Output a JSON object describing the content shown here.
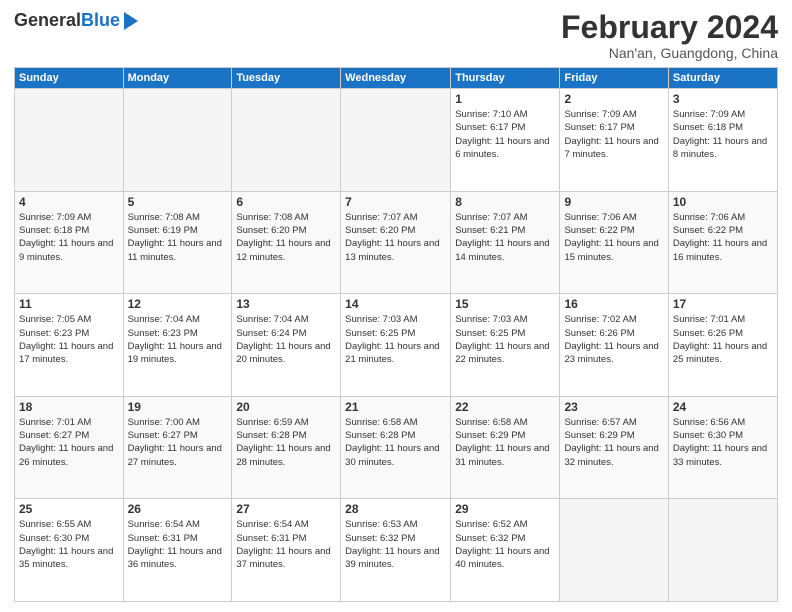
{
  "header": {
    "logo_line1": "General",
    "logo_line2": "Blue",
    "title": "February 2024",
    "location": "Nan'an, Guangdong, China"
  },
  "weekdays": [
    "Sunday",
    "Monday",
    "Tuesday",
    "Wednesday",
    "Thursday",
    "Friday",
    "Saturday"
  ],
  "weeks": [
    [
      {
        "day": "",
        "info": ""
      },
      {
        "day": "",
        "info": ""
      },
      {
        "day": "",
        "info": ""
      },
      {
        "day": "",
        "info": ""
      },
      {
        "day": "1",
        "info": "Sunrise: 7:10 AM\nSunset: 6:17 PM\nDaylight: 11 hours\nand 6 minutes."
      },
      {
        "day": "2",
        "info": "Sunrise: 7:09 AM\nSunset: 6:17 PM\nDaylight: 11 hours\nand 7 minutes."
      },
      {
        "day": "3",
        "info": "Sunrise: 7:09 AM\nSunset: 6:18 PM\nDaylight: 11 hours\nand 8 minutes."
      }
    ],
    [
      {
        "day": "4",
        "info": "Sunrise: 7:09 AM\nSunset: 6:18 PM\nDaylight: 11 hours\nand 9 minutes."
      },
      {
        "day": "5",
        "info": "Sunrise: 7:08 AM\nSunset: 6:19 PM\nDaylight: 11 hours\nand 11 minutes."
      },
      {
        "day": "6",
        "info": "Sunrise: 7:08 AM\nSunset: 6:20 PM\nDaylight: 11 hours\nand 12 minutes."
      },
      {
        "day": "7",
        "info": "Sunrise: 7:07 AM\nSunset: 6:20 PM\nDaylight: 11 hours\nand 13 minutes."
      },
      {
        "day": "8",
        "info": "Sunrise: 7:07 AM\nSunset: 6:21 PM\nDaylight: 11 hours\nand 14 minutes."
      },
      {
        "day": "9",
        "info": "Sunrise: 7:06 AM\nSunset: 6:22 PM\nDaylight: 11 hours\nand 15 minutes."
      },
      {
        "day": "10",
        "info": "Sunrise: 7:06 AM\nSunset: 6:22 PM\nDaylight: 11 hours\nand 16 minutes."
      }
    ],
    [
      {
        "day": "11",
        "info": "Sunrise: 7:05 AM\nSunset: 6:23 PM\nDaylight: 11 hours\nand 17 minutes."
      },
      {
        "day": "12",
        "info": "Sunrise: 7:04 AM\nSunset: 6:23 PM\nDaylight: 11 hours\nand 19 minutes."
      },
      {
        "day": "13",
        "info": "Sunrise: 7:04 AM\nSunset: 6:24 PM\nDaylight: 11 hours\nand 20 minutes."
      },
      {
        "day": "14",
        "info": "Sunrise: 7:03 AM\nSunset: 6:25 PM\nDaylight: 11 hours\nand 21 minutes."
      },
      {
        "day": "15",
        "info": "Sunrise: 7:03 AM\nSunset: 6:25 PM\nDaylight: 11 hours\nand 22 minutes."
      },
      {
        "day": "16",
        "info": "Sunrise: 7:02 AM\nSunset: 6:26 PM\nDaylight: 11 hours\nand 23 minutes."
      },
      {
        "day": "17",
        "info": "Sunrise: 7:01 AM\nSunset: 6:26 PM\nDaylight: 11 hours\nand 25 minutes."
      }
    ],
    [
      {
        "day": "18",
        "info": "Sunrise: 7:01 AM\nSunset: 6:27 PM\nDaylight: 11 hours\nand 26 minutes."
      },
      {
        "day": "19",
        "info": "Sunrise: 7:00 AM\nSunset: 6:27 PM\nDaylight: 11 hours\nand 27 minutes."
      },
      {
        "day": "20",
        "info": "Sunrise: 6:59 AM\nSunset: 6:28 PM\nDaylight: 11 hours\nand 28 minutes."
      },
      {
        "day": "21",
        "info": "Sunrise: 6:58 AM\nSunset: 6:28 PM\nDaylight: 11 hours\nand 30 minutes."
      },
      {
        "day": "22",
        "info": "Sunrise: 6:58 AM\nSunset: 6:29 PM\nDaylight: 11 hours\nand 31 minutes."
      },
      {
        "day": "23",
        "info": "Sunrise: 6:57 AM\nSunset: 6:29 PM\nDaylight: 11 hours\nand 32 minutes."
      },
      {
        "day": "24",
        "info": "Sunrise: 6:56 AM\nSunset: 6:30 PM\nDaylight: 11 hours\nand 33 minutes."
      }
    ],
    [
      {
        "day": "25",
        "info": "Sunrise: 6:55 AM\nSunset: 6:30 PM\nDaylight: 11 hours\nand 35 minutes."
      },
      {
        "day": "26",
        "info": "Sunrise: 6:54 AM\nSunset: 6:31 PM\nDaylight: 11 hours\nand 36 minutes."
      },
      {
        "day": "27",
        "info": "Sunrise: 6:54 AM\nSunset: 6:31 PM\nDaylight: 11 hours\nand 37 minutes."
      },
      {
        "day": "28",
        "info": "Sunrise: 6:53 AM\nSunset: 6:32 PM\nDaylight: 11 hours\nand 39 minutes."
      },
      {
        "day": "29",
        "info": "Sunrise: 6:52 AM\nSunset: 6:32 PM\nDaylight: 11 hours\nand 40 minutes."
      },
      {
        "day": "",
        "info": ""
      },
      {
        "day": "",
        "info": ""
      }
    ]
  ]
}
